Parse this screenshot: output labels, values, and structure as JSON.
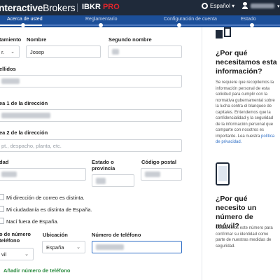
{
  "header": {
    "brand_bold": "nteractive",
    "brand_thin": "Brokers",
    "product_main": "IBKR ",
    "product_accent": "PRO",
    "language": "Español ▾",
    "user_caret": "▾",
    "accent_color": "#e0262b"
  },
  "steps": [
    {
      "label": "Acerca de usted",
      "active": true
    },
    {
      "label": "Reglamentario",
      "active": false
    },
    {
      "label": "Configuración de cuenta",
      "active": false
    },
    {
      "label": "Estado",
      "active": false
    }
  ],
  "form": {
    "treatment_label": "tamiento",
    "treatment_value": "r.",
    "first_name_label": "Nombre",
    "first_name_value": "Josep",
    "middle_name_label": "Segundo nombre",
    "surname_label": "ellidos",
    "address1_label": "ea 1 de la dirección",
    "address2_label": "ea 2 de la dirección",
    "address2_placeholder": "pt., despacho, planta, etc.",
    "city_label": "dad",
    "state_label": "Estado o provincia",
    "postal_label": "Código postal",
    "check_mailing": "Mi dirección de correo es distinta.",
    "check_citizenship": "Mi ciudadanía es distinta de España.",
    "check_born": "Nací fuera de España.",
    "phone_type_label": "o de número teléfono",
    "phone_type_value": "vil",
    "location_label": "Ubicación",
    "location_value": "España",
    "phone_number_label": "Número de teléfono",
    "add_phone": "Añadir número de teléfono"
  },
  "sidebar": {
    "why_info_title": "¿Por qué necesitamos esta información?",
    "why_info_text": "Se requiere que recopilemos la información personal de esta solicitud para cumplir con la normativa gubernamental sobre la lucha contra el blanqueo de capitales. Entendemos que la confidencialidad y la seguridad de la información personal que comparte con nosotros es importante. Lea nuestra ",
    "why_info_link": "política de privacidad.",
    "why_phone_title": "¿Por qué necesito un número de móvil?",
    "why_phone_text": "Utilizaremos este número para confirmar su identidad como parte de nuestras medidas de seguridad."
  }
}
